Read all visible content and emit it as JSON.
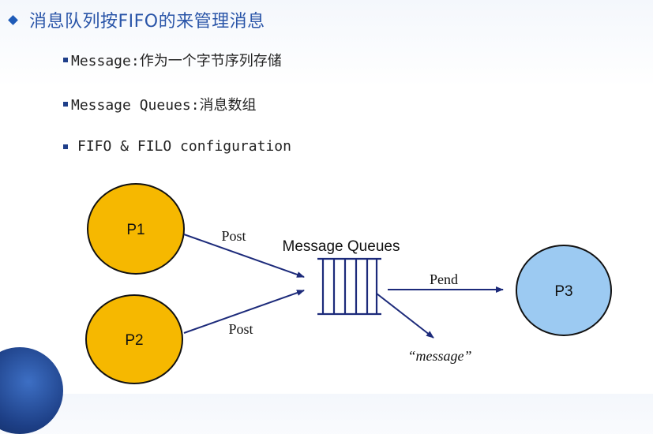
{
  "title": "消息队列按FIFO的来管理消息",
  "bullets": [
    "Message:作为一个字节序列存储",
    "Message Queues:消息数组",
    "FIFO & FILO configuration"
  ],
  "diagram": {
    "nodes": {
      "p1": "P1",
      "p2": "P2",
      "p3": "P3"
    },
    "queue_label": "Message Queues",
    "edges": {
      "p1_post": "Post",
      "p2_post": "Post",
      "pend": "Pend"
    },
    "message_label": "“message”",
    "colors": {
      "producer_fill": "#f6b800",
      "consumer_fill": "#9ccaf2",
      "arrow": "#1c2a7a",
      "node_stroke": "#111111"
    }
  }
}
